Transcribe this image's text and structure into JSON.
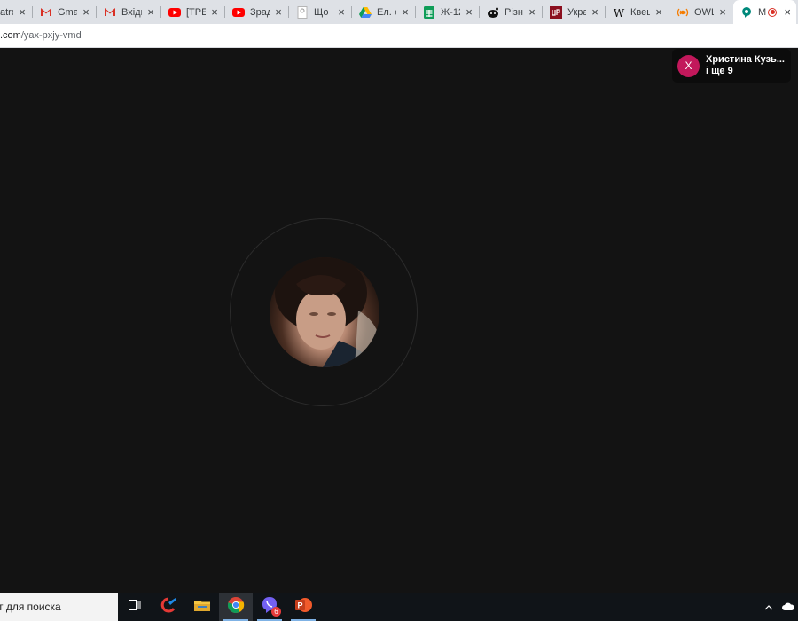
{
  "browser": {
    "tabs": [
      {
        "title": "atrol",
        "icon": "none",
        "active": false
      },
      {
        "title": "Gmail",
        "icon": "gmail-icon",
        "active": false
      },
      {
        "title": "Вхідні",
        "icon": "gmail-icon",
        "active": false
      },
      {
        "title": "[ТРЕL",
        "icon": "youtube-icon",
        "active": false
      },
      {
        "title": "Зрад",
        "icon": "youtube-icon",
        "active": false
      },
      {
        "title": "Що р",
        "icon": "page-icon",
        "active": false
      },
      {
        "title": "Ел. ж",
        "icon": "google-drive-icon",
        "active": false
      },
      {
        "title": "Ж-12",
        "icon": "google-sheets-icon",
        "active": false
      },
      {
        "title": "Різни",
        "icon": "reddit-icon",
        "active": false
      },
      {
        "title": "Укра",
        "icon": "up-logo-icon",
        "active": false
      },
      {
        "title": "Квец",
        "icon": "wikipedia-icon",
        "active": false
      },
      {
        "title": "OWL",
        "icon": "owl-icon",
        "active": false
      },
      {
        "title": "M",
        "icon": "google-meet-icon",
        "active": true,
        "recording": true
      }
    ],
    "close_glyph": "×",
    "url": {
      "domain": ".com",
      "path": "/yax-pxjy-vmd"
    }
  },
  "meet": {
    "participants_pill": {
      "initial": "X",
      "name": "Христина Кузь...",
      "more": "і ще 9"
    },
    "initial_color": "#c2185b"
  },
  "taskbar": {
    "search_text": "т для поиска",
    "apps": [
      {
        "name": "task-view-icon",
        "active": false
      },
      {
        "name": "ccleaner-icon",
        "active": false
      },
      {
        "name": "file-explorer-icon",
        "active": false
      },
      {
        "name": "chrome-icon",
        "active": true
      },
      {
        "name": "viber-icon",
        "active": false,
        "badge": "6"
      },
      {
        "name": "powerpoint-icon",
        "active": false
      }
    ]
  }
}
